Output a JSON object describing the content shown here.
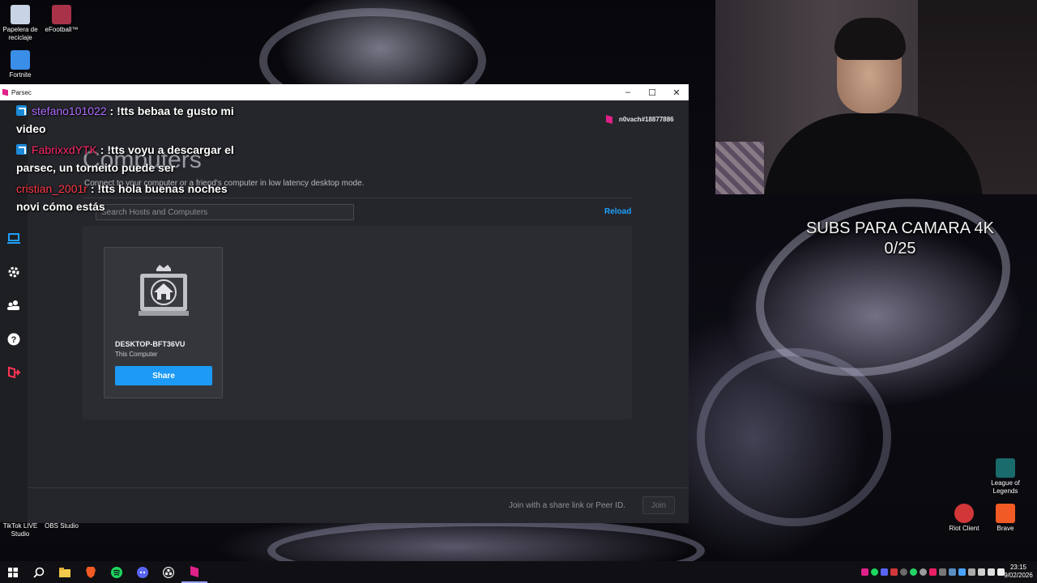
{
  "desktop": {
    "icons": [
      {
        "label": "Papelera de reciclaje",
        "color": "#c8d4e6"
      },
      {
        "label": "eFootball™",
        "color": "#a83248"
      },
      {
        "label": "Fortnite",
        "color": "#3a8ee8"
      },
      {
        "label": "TikTok LIVE Studio",
        "color": "#222222"
      },
      {
        "label": "OBS Studio",
        "color": "#333333"
      },
      {
        "label": "League of Legends",
        "color": "#1a6b6b"
      },
      {
        "label": "Riot Client",
        "color": "#d13639"
      },
      {
        "label": "Brave",
        "color": "#f15a24"
      }
    ]
  },
  "overlay": {
    "subs_title": "SUBS PARA CAMARA 4K",
    "subs_count": "0/25"
  },
  "chat": {
    "messages": [
      {
        "user": "stefano101022",
        "text": " : !tts bebaa te gusto mi video"
      },
      {
        "user": "FabrixxdYTK",
        "text": " : !tts voyu a descargar el parsec, un torneito puede ser"
      },
      {
        "user": "cristian_2001r",
        "text": " : !tts hola buenas noches novi cómo estás"
      }
    ]
  },
  "window": {
    "title": "Parsec",
    "minimize": "–",
    "maximize": "☐",
    "close": "✕"
  },
  "parsec": {
    "user_id": "n0vach#18877886",
    "page_title": "Computers",
    "page_subtitle": "Connect to your computer or a friend's computer in low latency desktop mode.",
    "search_placeholder": "Search Hosts and Computers",
    "reload_label": "Reload",
    "host": {
      "name": "DESKTOP-BFT36VU",
      "subtitle": "This Computer",
      "share_label": "Share"
    },
    "join_hint": "Join with a share link or Peer ID.",
    "join_label": "Join",
    "nav": [
      "computers-icon",
      "settings-icon",
      "friends-icon",
      "help-icon",
      "logout-icon"
    ],
    "accent": "#1c9af5",
    "brand": "#e0218a"
  },
  "taskbar": {
    "apps": [
      "start-icon",
      "search-icon",
      "file-explorer-icon",
      "brave-icon",
      "spotify-icon",
      "discord-icon",
      "obs-icon",
      "parsec-icon"
    ],
    "time": "23:15",
    "date": "9/02/2026"
  }
}
